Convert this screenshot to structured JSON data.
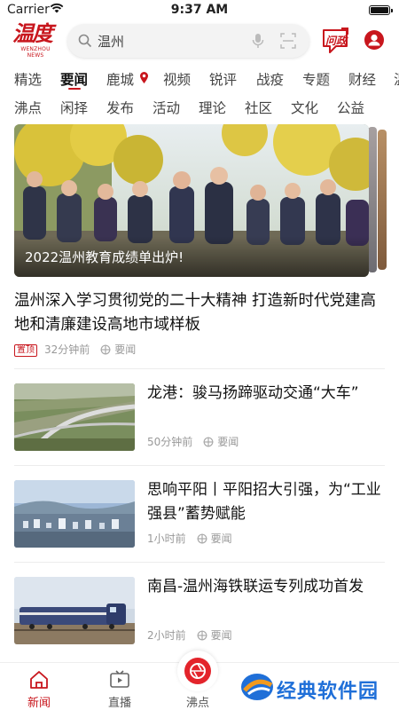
{
  "status_bar": {
    "carrier": "Carrier",
    "time": "9:37 AM"
  },
  "header": {
    "logo_text": "温度",
    "logo_subtext": "WENZHOU NEWS",
    "search_value": "温州",
    "wenzheng_label": "问政"
  },
  "tabs_row1": [
    "精选",
    "要闻",
    "鹿城",
    "视频",
    "锐评",
    "战疫",
    "专题",
    "财经",
    "温"
  ],
  "tabs_row1_active": "要闻",
  "tabs_row2": [
    "沸点",
    "闲择",
    "发布",
    "活动",
    "理论",
    "社区",
    "文化",
    "公益"
  ],
  "banner": {
    "caption": "2022温州教育成绩单出炉!"
  },
  "headline": {
    "title": "温州深入学习贯彻党的二十大精神 打造新时代党建高地和清廉建设高地市域样板",
    "tag": "置顶",
    "time": "32分钟前",
    "channel": "要闻"
  },
  "news_items": [
    {
      "title": "龙港：骏马扬蹄驱动交通“大车”",
      "time": "50分钟前",
      "channel": "要闻"
    },
    {
      "title": "思响平阳丨平阳招大引强，为“工业强县”蓄势赋能",
      "time": "1小时前",
      "channel": "要闻"
    },
    {
      "title": "南昌-温州海铁联运专列成功首发",
      "time": "2小时前",
      "channel": "要闻"
    }
  ],
  "bottom_nav": {
    "items": [
      "新闻",
      "直播",
      "沸点"
    ],
    "active": "新闻"
  },
  "watermark": "经典软件园",
  "colors": {
    "accent": "#c8161d",
    "watermark": "#1f6fd8"
  }
}
